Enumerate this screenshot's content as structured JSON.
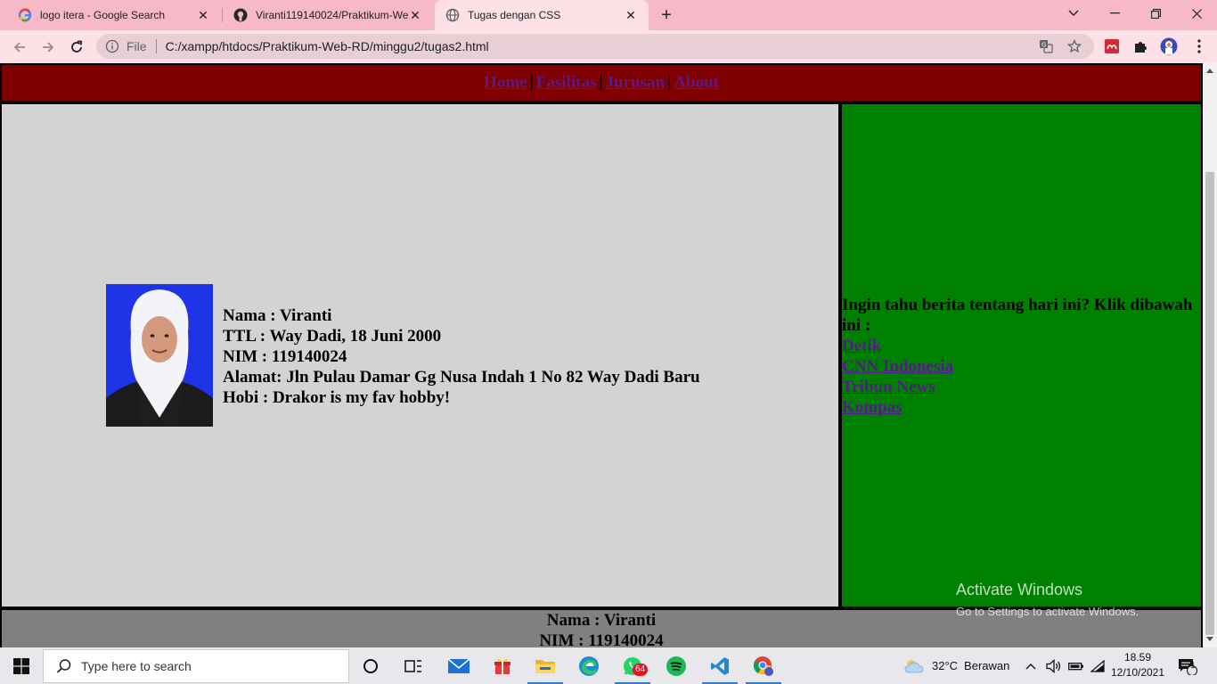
{
  "browser": {
    "tabs": [
      {
        "title": "logo itera - Google Search",
        "icon": "google-icon",
        "active": false
      },
      {
        "title": "Viranti119140024/Praktikum-Web",
        "icon": "github-icon",
        "active": false
      },
      {
        "title": "Tugas dengan CSS",
        "icon": "globe-icon",
        "active": true
      }
    ],
    "new_tab": "+",
    "window_controls": {
      "minimize": "—",
      "maximize": "❐",
      "close": "✕",
      "tab_list": "⌄"
    },
    "omnibox": {
      "scheme": "File",
      "url": "C:/xampp/htdocs/Praktikum-Web-RD/minggu2/tugas2.html"
    }
  },
  "page": {
    "nav": [
      {
        "label": "Home "
      },
      {
        "label": "Fasilitas "
      },
      {
        "label": "Jurusan "
      },
      {
        "label": "About"
      }
    ],
    "nav_separator": "|",
    "bio": {
      "nama": "Nama : Viranti",
      "ttl": "TTL : Way Dadi, 18 Juni 2000",
      "nim": "NIM : 119140024",
      "alamat": "Alamat: Jln Pulau Damar Gg Nusa Indah 1 No 82 Way Dadi Baru",
      "hobi": "Hobi : Drakor is my fav hobby!"
    },
    "aside": {
      "intro": "Ingin tahu berita tentang hari ini? Klik dibawah ini :",
      "links": [
        "Detik",
        "CNN Indonesia",
        "Tribun News",
        "Kompas"
      ]
    },
    "footer": {
      "nama": "Nama : Viranti",
      "nim": "NIM : 119140024"
    },
    "colors": {
      "nav_bg": "#800000",
      "content_bg": "#d3d3d3",
      "aside_bg": "#008000",
      "footer_bg": "#808080",
      "link": "#551a8b"
    }
  },
  "watermark": {
    "line1": "Activate Windows",
    "line2": "Go to Settings to activate Windows."
  },
  "taskbar": {
    "search_placeholder": "Type here to search",
    "whatsapp_badge": "64",
    "weather": {
      "temp": "32°C",
      "condition": "Berawan"
    },
    "clock": {
      "time": "18.59",
      "date": "12/10/2021"
    },
    "notification_count": "1"
  }
}
